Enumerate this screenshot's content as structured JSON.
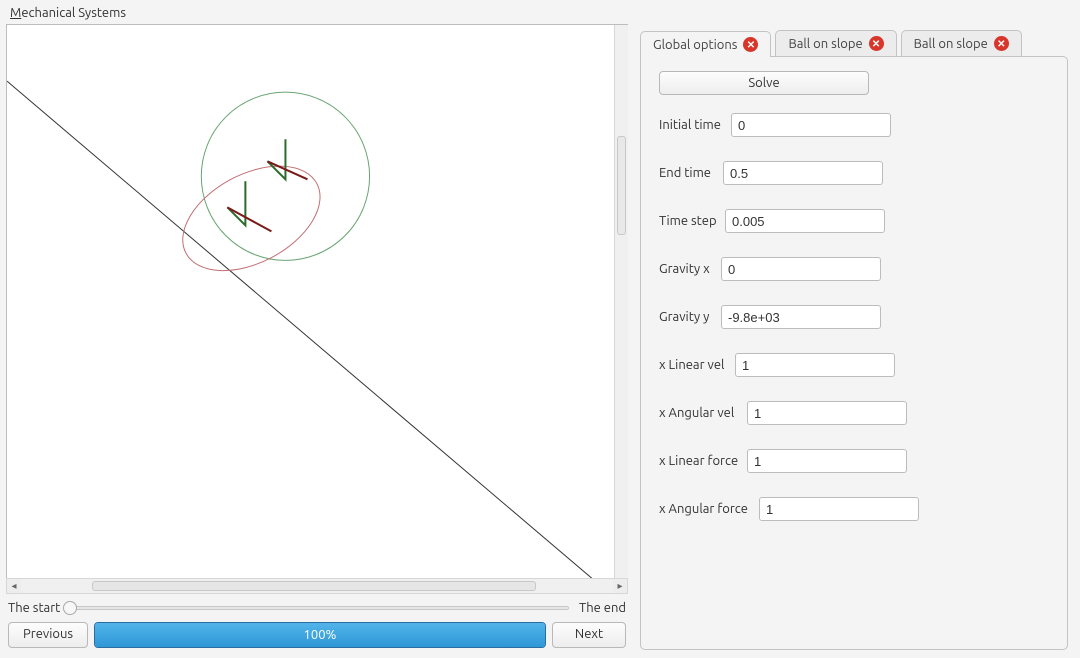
{
  "window": {
    "title": "Mechanical Systems"
  },
  "slider": {
    "start_label": "The start",
    "end_label": "The end"
  },
  "controls": {
    "prev_label": "Previous",
    "next_label": "Next",
    "progress_text": "100%"
  },
  "tabs": [
    {
      "label": "Global options",
      "active": true
    },
    {
      "label": "Ball on slope",
      "active": false
    },
    {
      "label": "Ball on slope",
      "active": false
    }
  ],
  "panel": {
    "solve_label": "Solve",
    "fields": {
      "initial_time": {
        "label": "Initial time",
        "value": "0"
      },
      "end_time": {
        "label": "End time",
        "value": "0.5"
      },
      "time_step": {
        "label": "Time step",
        "value": "0.005"
      },
      "gravity_x": {
        "label": "Gravity x",
        "value": "0"
      },
      "gravity_y": {
        "label": "Gravity y",
        "value": "-9.8e+03"
      },
      "x_linear_vel": {
        "label": "x Linear vel",
        "value": "1"
      },
      "x_angular_vel": {
        "label": "x Angular vel",
        "value": "1"
      },
      "x_linear_force": {
        "label": "x Linear force",
        "value": "1"
      },
      "x_angular_force": {
        "label": "x Angular force",
        "value": "1"
      }
    }
  }
}
